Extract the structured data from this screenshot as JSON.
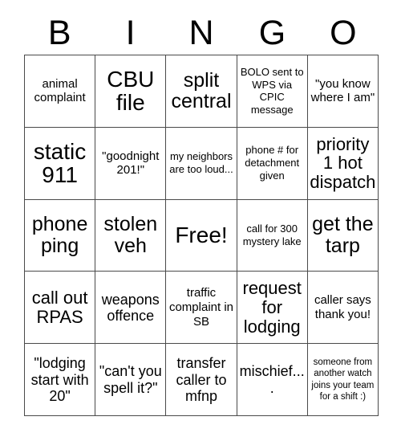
{
  "card": {
    "header_letters": [
      "B",
      "I",
      "N",
      "G",
      "O"
    ],
    "columns": 5,
    "rows": 5,
    "free_space_label": "Free!",
    "grid_line_color": "#4a4a4a",
    "text_color": "#000000",
    "background_color": "#ffffff",
    "cells": [
      [
        {
          "text": "animal complaint",
          "size": "sm",
          "free": false
        },
        {
          "text": "CBU file",
          "size": "xxl",
          "free": false
        },
        {
          "text": "split central",
          "size": "xl",
          "free": false
        },
        {
          "text": "BOLO sent to WPS via CPIC message",
          "size": "xs",
          "free": false
        },
        {
          "text": "\"you know where I am\"",
          "size": "sm",
          "free": false
        }
      ],
      [
        {
          "text": "static 911",
          "size": "xxl",
          "free": false
        },
        {
          "text": "\"goodnight 201!\"",
          "size": "sm",
          "free": false
        },
        {
          "text": "my neighbors are too loud...",
          "size": "xs",
          "free": false
        },
        {
          "text": "phone # for detachment given",
          "size": "xs",
          "free": false
        },
        {
          "text": "priority 1 hot dispatch",
          "size": "lg",
          "free": false
        }
      ],
      [
        {
          "text": "phone ping",
          "size": "xl",
          "free": false
        },
        {
          "text": "stolen veh",
          "size": "xl",
          "free": false
        },
        {
          "text": "Free!",
          "size": "xxl",
          "free": true
        },
        {
          "text": "call for 300 mystery lake",
          "size": "xs",
          "free": false
        },
        {
          "text": "get the tarp",
          "size": "xl",
          "free": false
        }
      ],
      [
        {
          "text": "call out RPAS",
          "size": "lg",
          "free": false
        },
        {
          "text": "weapons offence",
          "size": "md",
          "free": false
        },
        {
          "text": "traffic complaint in SB",
          "size": "sm",
          "free": false
        },
        {
          "text": "request for lodging",
          "size": "lg",
          "free": false
        },
        {
          "text": "caller says thank you!",
          "size": "sm",
          "free": false
        }
      ],
      [
        {
          "text": "\"lodging start with 20\"",
          "size": "md",
          "free": false
        },
        {
          "text": "\"can't you spell it?\"",
          "size": "md",
          "free": false
        },
        {
          "text": "transfer caller to mfnp",
          "size": "md",
          "free": false
        },
        {
          "text": "mischief....",
          "size": "md",
          "free": false
        },
        {
          "text": "someone from another watch joins your team for a shift :)",
          "size": "xxs",
          "free": false
        }
      ]
    ]
  }
}
